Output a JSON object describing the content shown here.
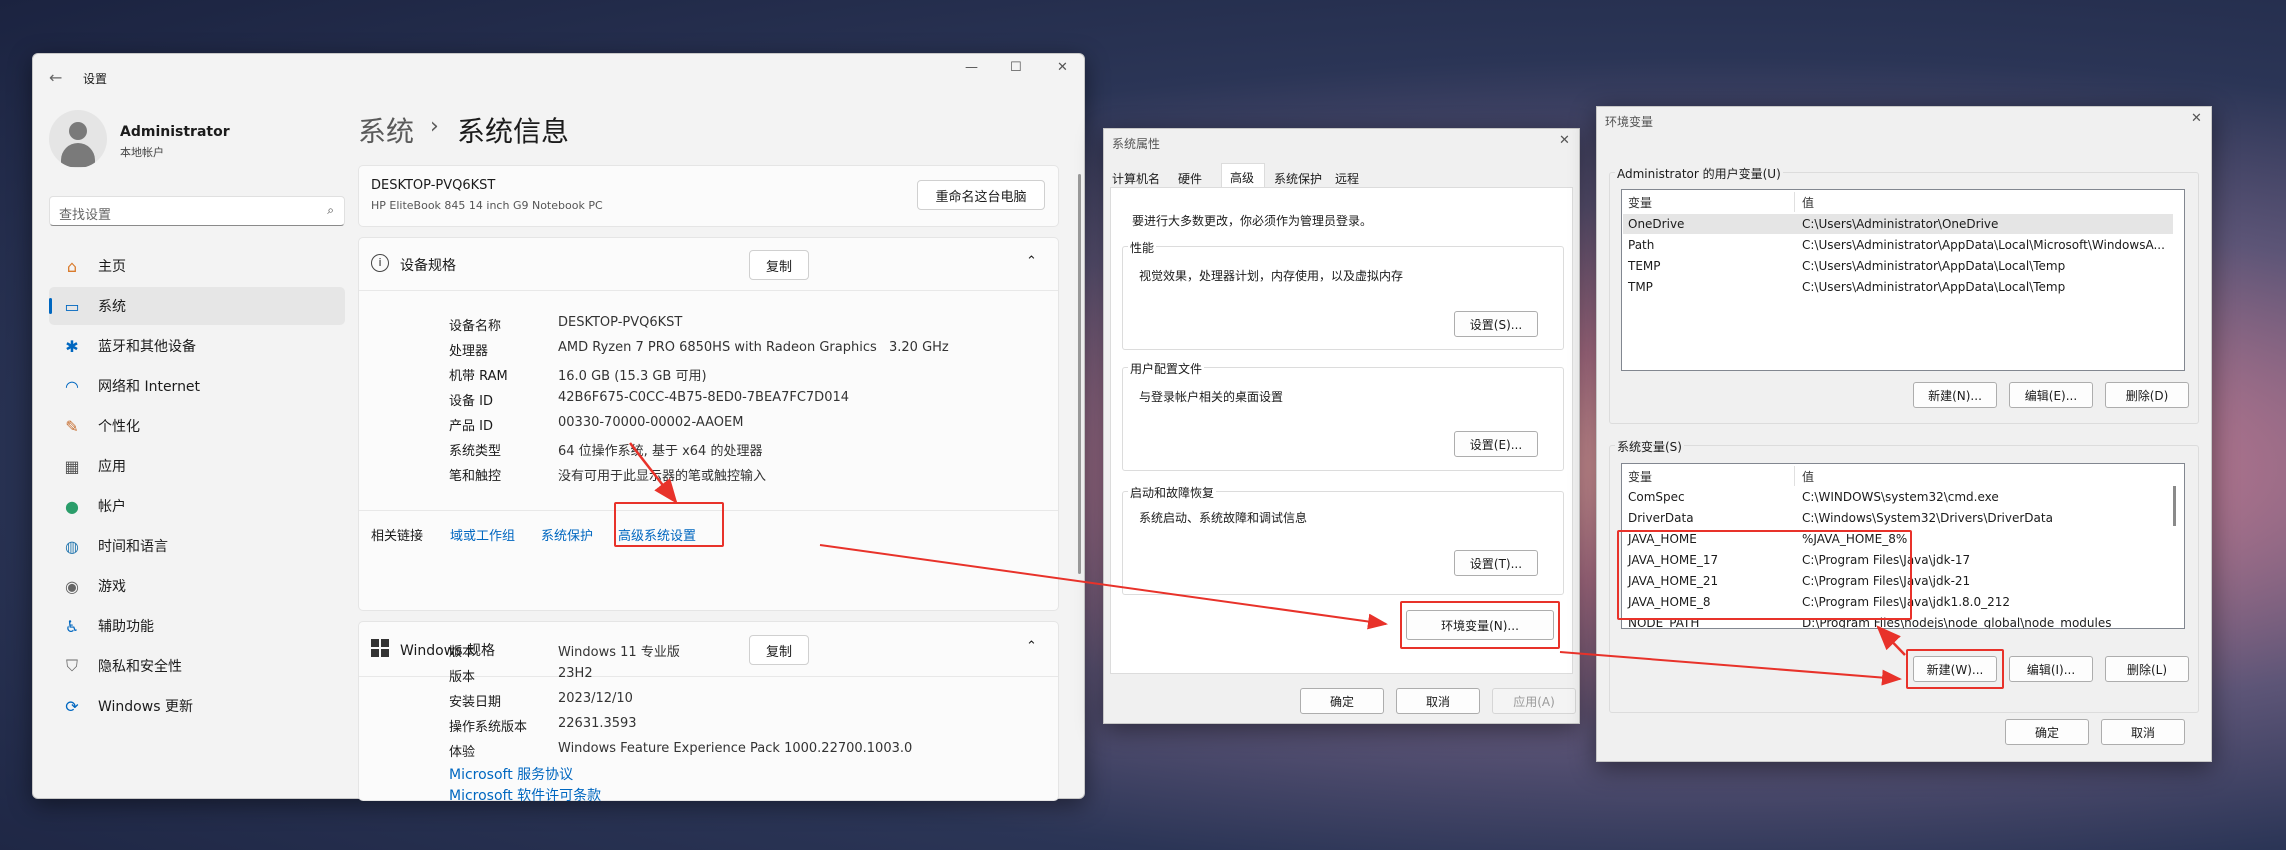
{
  "settings": {
    "title": "设置",
    "user": {
      "name": "Administrator",
      "role": "本地帐户"
    },
    "search_placeholder": "查找设置",
    "nav": [
      {
        "label": "主页",
        "icon": "home-icon"
      },
      {
        "label": "系统",
        "icon": "system-icon"
      },
      {
        "label": "蓝牙和其他设备",
        "icon": "bluetooth-icon"
      },
      {
        "label": "网络和 Internet",
        "icon": "wifi-icon"
      },
      {
        "label": "个性化",
        "icon": "brush-icon"
      },
      {
        "label": "应用",
        "icon": "apps-icon"
      },
      {
        "label": "帐户",
        "icon": "account-icon"
      },
      {
        "label": "时间和语言",
        "icon": "globe-icon"
      },
      {
        "label": "游戏",
        "icon": "gamepad-icon"
      },
      {
        "label": "辅助功能",
        "icon": "accessibility-icon"
      },
      {
        "label": "隐私和安全性",
        "icon": "shield-icon"
      },
      {
        "label": "Windows 更新",
        "icon": "update-icon"
      }
    ],
    "breadcrumb_parent": "系统",
    "breadcrumb_sep": "›",
    "breadcrumb_current": "系统信息",
    "device_name": "DESKTOP-PVQ6KST",
    "device_model": "HP EliteBook 845 14 inch G9 Notebook PC",
    "rename_label": "重命名这台电脑",
    "device_specs_title": "设备规格",
    "copy_label": "复制",
    "specs": [
      {
        "k": "设备名称",
        "v": "DESKTOP-PVQ6KST"
      },
      {
        "k": "处理器",
        "v": "AMD Ryzen 7 PRO 6850HS with Radeon Graphics",
        "v2": "3.20 GHz"
      },
      {
        "k": "机带 RAM",
        "v": "16.0 GB (15.3 GB 可用)"
      },
      {
        "k": "设备 ID",
        "v": "42B6F675-C0CC-4B75-8ED0-7BEA7FC7D014"
      },
      {
        "k": "产品 ID",
        "v": "00330-70000-00002-AAOEM"
      },
      {
        "k": "系统类型",
        "v": "64 位操作系统, 基于 x64 的处理器"
      },
      {
        "k": "笔和触控",
        "v": "没有可用于此显示器的笔或触控输入"
      }
    ],
    "related_label": "相关链接",
    "related_links": [
      "域或工作组",
      "系统保护",
      "高级系统设置"
    ],
    "windows_specs_title": "Windows 规格",
    "win_specs": [
      {
        "k": "版本",
        "v": "Windows 11 专业版"
      },
      {
        "k": "版本",
        "v": "23H2"
      },
      {
        "k": "安装日期",
        "v": "2023/12/10"
      },
      {
        "k": "操作系统版本",
        "v": "22631.3593"
      },
      {
        "k": "体验",
        "v": "Windows Feature Experience Pack 1000.22700.1003.0"
      }
    ],
    "links": [
      "Microsoft 服务协议",
      "Microsoft 软件许可条款"
    ]
  },
  "sysprops": {
    "title": "系统属性",
    "tabs": [
      "计算机名",
      "硬件",
      "高级",
      "系统保护",
      "远程"
    ],
    "active_tab": "高级",
    "admin_note": "要进行大多数更改，你必须作为管理员登录。",
    "perf_title": "性能",
    "perf_desc": "视觉效果，处理器计划，内存使用，以及虚拟内存",
    "perf_btn": "设置(S)...",
    "profile_title": "用户配置文件",
    "profile_desc": "与登录帐户相关的桌面设置",
    "profile_btn": "设置(E)...",
    "startup_title": "启动和故障恢复",
    "startup_desc": "系统启动、系统故障和调试信息",
    "startup_btn": "设置(T)...",
    "env_btn": "环境变量(N)...",
    "ok": "确定",
    "cancel": "取消",
    "apply": "应用(A)"
  },
  "envvars": {
    "title": "环境变量",
    "user_group": "Administrator 的用户变量(U)",
    "col_var": "变量",
    "col_val": "值",
    "user_vars": [
      {
        "k": "OneDrive",
        "v": "C:\\Users\\Administrator\\OneDrive"
      },
      {
        "k": "Path",
        "v": "C:\\Users\\Administrator\\AppData\\Local\\Microsoft\\WindowsA..."
      },
      {
        "k": "TEMP",
        "v": "C:\\Users\\Administrator\\AppData\\Local\\Temp"
      },
      {
        "k": "TMP",
        "v": "C:\\Users\\Administrator\\AppData\\Local\\Temp"
      }
    ],
    "user_new": "新建(N)...",
    "user_edit": "编辑(E)...",
    "user_delete": "删除(D)",
    "sys_group": "系统变量(S)",
    "sys_vars": [
      {
        "k": "ComSpec",
        "v": "C:\\WINDOWS\\system32\\cmd.exe"
      },
      {
        "k": "DriverData",
        "v": "C:\\Windows\\System32\\Drivers\\DriverData"
      },
      {
        "k": "JAVA_HOME",
        "v": "%JAVA_HOME_8%"
      },
      {
        "k": "JAVA_HOME_17",
        "v": "C:\\Program Files\\Java\\jdk-17"
      },
      {
        "k": "JAVA_HOME_21",
        "v": "C:\\Program Files\\Java\\jdk-21"
      },
      {
        "k": "JAVA_HOME_8",
        "v": "C:\\Program Files\\Java\\jdk1.8.0_212"
      },
      {
        "k": "NODE_PATH",
        "v": "D:\\Program Files\\nodejs\\node_global\\node_modules"
      }
    ],
    "sys_new": "新建(W)...",
    "sys_edit": "编辑(I)...",
    "sys_delete": "删除(L)",
    "ok": "确定",
    "cancel": "取消"
  },
  "colors": {
    "accent": "#0067c0",
    "annotation": "#e8322a"
  }
}
